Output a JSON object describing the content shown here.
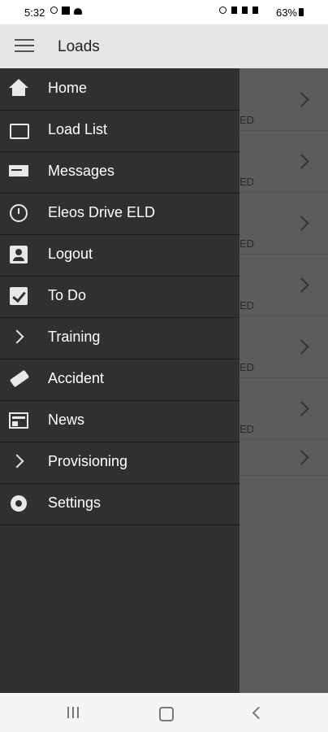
{
  "status_bar": {
    "time": "5:32",
    "battery": "63%"
  },
  "app_bar": {
    "title": "Loads"
  },
  "drawer": {
    "items": [
      {
        "label": "Home",
        "icon": "home-icon"
      },
      {
        "label": "Load List",
        "icon": "load-list-icon"
      },
      {
        "label": "Messages",
        "icon": "messages-icon"
      },
      {
        "label": "Eleos Drive ELD",
        "icon": "timer-icon"
      },
      {
        "label": "Logout",
        "icon": "account-box-icon"
      },
      {
        "label": "To Do",
        "icon": "checkbox-icon"
      },
      {
        "label": "Training",
        "icon": "chevron-right-icon"
      },
      {
        "label": "Accident",
        "icon": "eraser-icon"
      },
      {
        "label": "News",
        "icon": "news-icon"
      },
      {
        "label": "Provisioning",
        "icon": "chevron-right-icon"
      },
      {
        "label": "Settings",
        "icon": "gear-icon"
      }
    ]
  },
  "background_list": {
    "row_suffix": "ED",
    "rows": 7
  },
  "colors": {
    "drawer_bg": "#303030",
    "app_bar_bg": "#e6e6e6",
    "scrim": "#5c5c5c"
  }
}
